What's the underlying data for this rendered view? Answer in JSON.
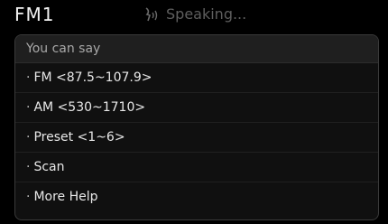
{
  "header": {
    "title": "FM1",
    "status_text": "Speaking...",
    "status_icon": "voice-speaking-icon"
  },
  "panel": {
    "header": "You can say",
    "bullet": "·",
    "items": [
      {
        "label": "FM <87.5~107.9>"
      },
      {
        "label": "AM <530~1710>"
      },
      {
        "label": "Preset <1~6>"
      },
      {
        "label": "Scan"
      },
      {
        "label": "More Help"
      }
    ]
  }
}
